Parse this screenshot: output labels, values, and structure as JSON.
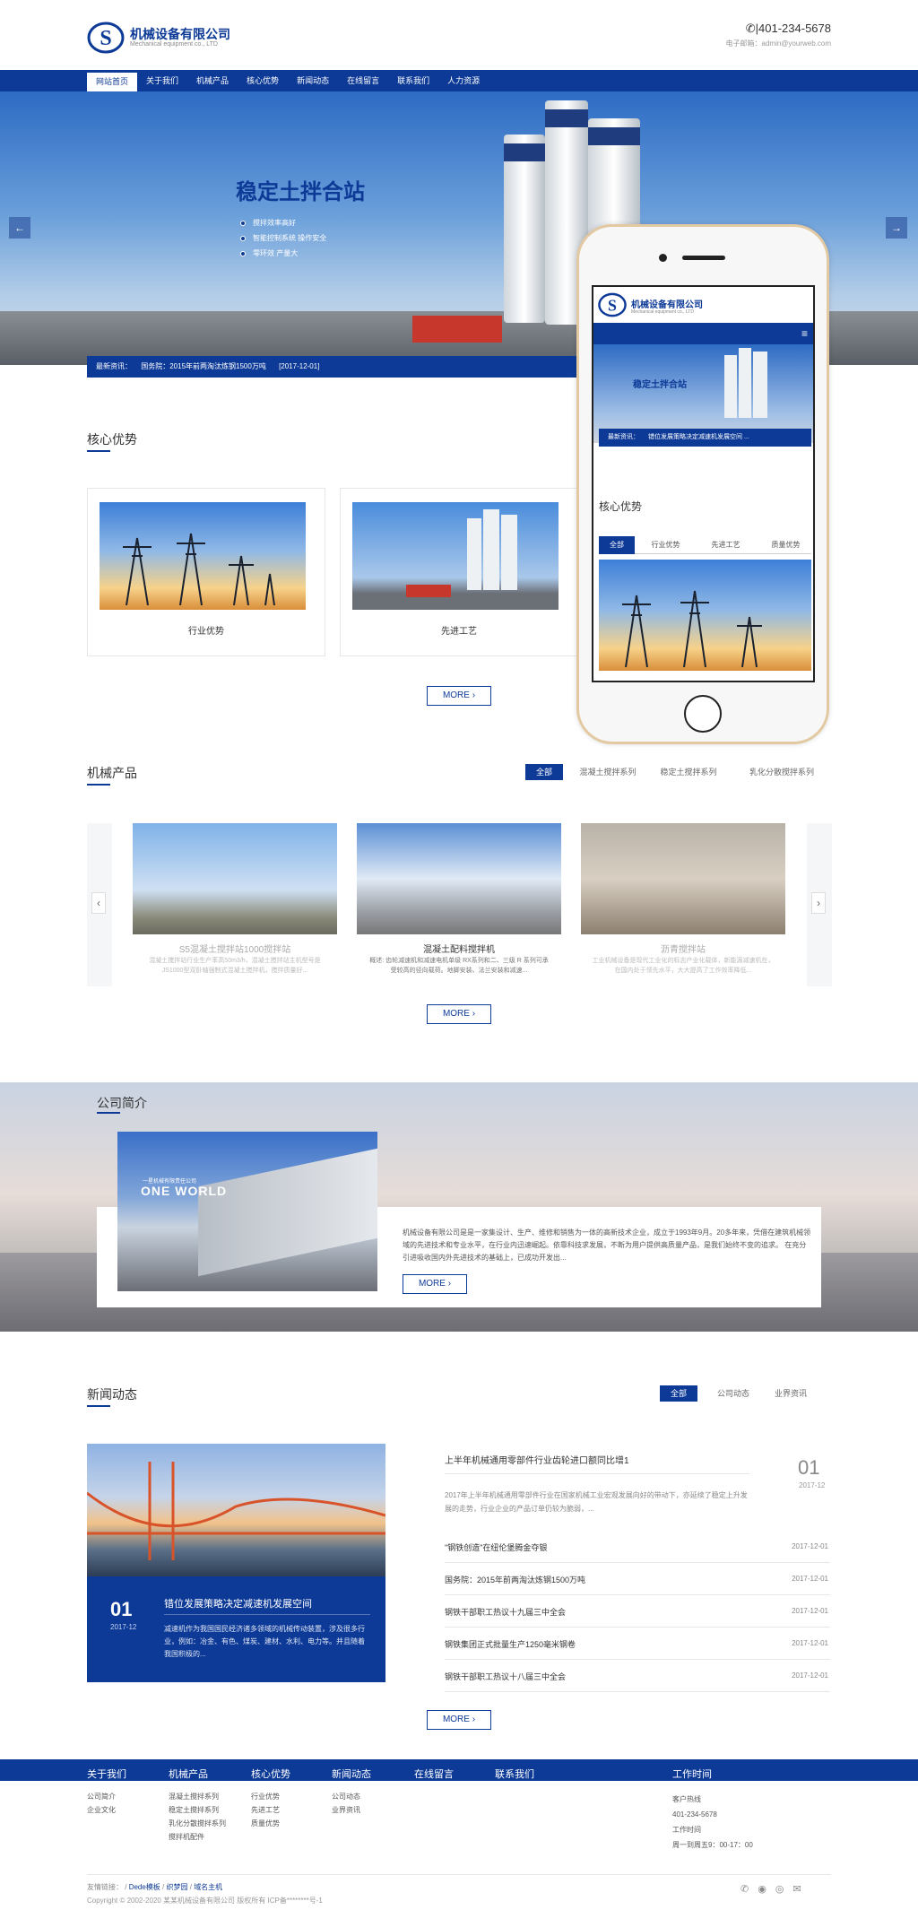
{
  "header": {
    "company": "机械设备有限公司",
    "company_en": "Mechanical equipment co., LTD",
    "phone": "401-234-5678",
    "email": "电子邮箱：admin@yourweb.com"
  },
  "nav": [
    "网站首页",
    "关于我们",
    "机械产品",
    "核心优势",
    "新闻动态",
    "在线留言",
    "联系我们",
    "人力资源"
  ],
  "banner": {
    "title": "稳定土拌合站",
    "bullets": [
      "搅拌效率高好",
      "智能控制系统 操作安全",
      "零环效 产量大"
    ],
    "news_label": "最新资讯：",
    "news_text": "国务院：2015年前两淘汰炼钢1500万吨",
    "news_date": "[2017-12-01]",
    "prev": "←",
    "next": "→"
  },
  "core": {
    "title": "核心优势",
    "items": [
      "行业优势",
      "先进工艺"
    ],
    "more": "MORE"
  },
  "phone_mock": {
    "company": "机械设备有限公司",
    "company_en": "Mechanical equipment co., LTD",
    "banner_title": "稳定土拌合站",
    "news_label": "最新资讯：",
    "news_text": "错位发展策略决定减速机发展空间 ...",
    "core_title": "核心优势",
    "tabs": [
      "全部",
      "行业优势",
      "先进工艺",
      "质量优势"
    ]
  },
  "products": {
    "title": "机械产品",
    "tabs": [
      "全部",
      "混凝土搅拌系列",
      "稳定土搅拌系列",
      "乳化分散搅拌系列"
    ],
    "items": [
      {
        "name": "S5混凝土搅拌站1000搅拌站",
        "desc": "混凝土搅拌站行业生产率高50m3/h，混凝土搅拌站主机型号是JS1000型双卧轴强制式混凝土搅拌机，搅拌质量好..."
      },
      {
        "name": "混凝土配料搅拌机",
        "desc": "概述: 齿轮减速机和减速电机单级 RX系列和二、三级 R 系列可承受较高的径向载荷。地脚安装、法兰安装和减速..."
      },
      {
        "name": "沥青搅拌站",
        "desc": "工业机械设备是现代工业化的标志产业化载体，新能源减速机在，在国内处于领先水平，大大提高了工作效率降低..."
      }
    ],
    "prev": "‹",
    "next": "›",
    "more": "MORE"
  },
  "about": {
    "title": "公司简介",
    "img_text_small": "一星机械有限责任公司",
    "img_text": "ONE WORLD",
    "text": "机械设备有限公司是是一家集设计、生产、维修和销售为一体的高新技术企业，成立于1993年9月。20多年来，凭借在建筑机械领域的先进技术和专业水平，在行业内迅速崛起。依靠科技求发展，不断为用户提供高质量产品，是我们始终不变的追求。 在充分引进吸收国内外先进技术的基础上，已成功开发出...",
    "more": "MORE"
  },
  "news": {
    "title": "新闻动态",
    "tabs": [
      "全部",
      "公司动态",
      "业界资讯"
    ],
    "feature": {
      "day": "01",
      "ym": "2017-12",
      "title": "错位发展策略决定减速机发展空间",
      "desc": "减速机作为我国国民经济诸多领域的机械传动装置，涉及很多行业，例如：冶金、有色、煤炭、建材、水利、电力等。并且随着我国积极的..."
    },
    "top": {
      "title": "上半年机械通用零部件行业齿轮进口额同比增1",
      "desc": "2017年上半年机械通用零部件行业在国家机械工业宏观发展向好的带动下，亦延续了稳定上升发展的走势，行业企业的产品订单仍较为脆弱，...",
      "day": "01",
      "ym": "2017-12"
    },
    "list": [
      {
        "title": "\"钢铁创造\"在纽伦堡腾金夺银",
        "date": "2017-12-01"
      },
      {
        "title": "国务院：2015年前两淘汰炼钢1500万吨",
        "date": "2017-12-01"
      },
      {
        "title": "钢铁干部职工热议十九届三中全会",
        "date": "2017-12-01"
      },
      {
        "title": "钢铁集团正式批量生产1250毫米钢卷",
        "date": "2017-12-01"
      },
      {
        "title": "钢铁干部职工热议十八届三中全会",
        "date": "2017-12-01"
      }
    ],
    "more": "MORE"
  },
  "footer": {
    "heads": [
      "关于我们",
      "机械产品",
      "核心优势",
      "新闻动态",
      "在线留言",
      "联系我们",
      "工作时间"
    ],
    "col1": [
      "公司简介",
      "企业文化"
    ],
    "col2": [
      "混凝土搅拌系列",
      "稳定土搅拌系列",
      "乳化分散搅拌系列",
      "搅拌机配件"
    ],
    "col3": [
      "行业优势",
      "先进工艺",
      "质量优势"
    ],
    "col4": [
      "公司动态",
      "业界资讯"
    ],
    "contact": [
      "客户热线",
      "401-234-5678",
      "工作时间",
      "周一到周五9：00-17：00"
    ],
    "links_label": "友情链接：",
    "links": [
      "Dede模板",
      "织梦园",
      "域名主机"
    ],
    "copyright": "Copyright © 2002-2020 某某机械设备有限公司 版权所有 ICP备********号-1"
  }
}
